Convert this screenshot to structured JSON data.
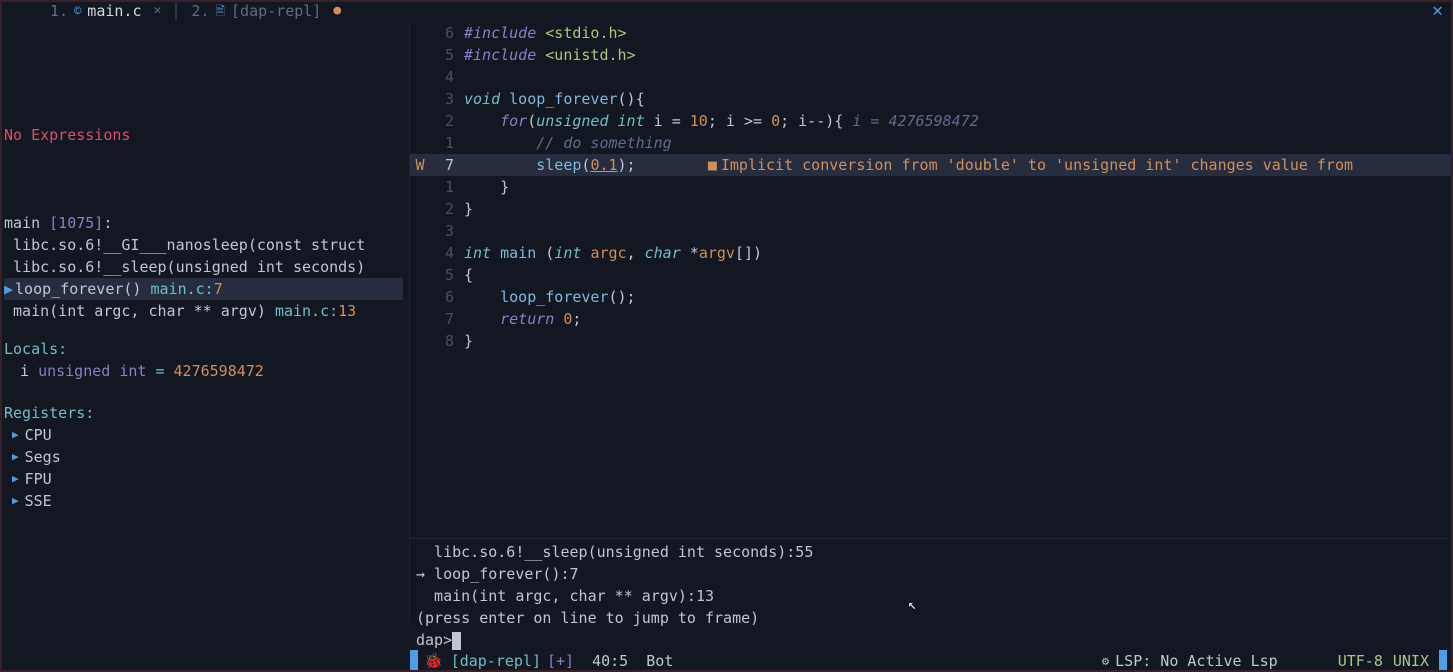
{
  "tabs": [
    {
      "num": "1.",
      "icon": "©",
      "label": "main.c",
      "active": true,
      "closable": true
    },
    {
      "num": "2.",
      "icon": "🗎",
      "label": "[dap-repl]",
      "active": false,
      "unsaved": true
    }
  ],
  "editor": {
    "diag_prefix": "W",
    "lines": [
      {
        "n": "6",
        "sign": "",
        "html": "<span class='kw'>#include</span> <span class='str'>&lt;stdio.h&gt;</span>"
      },
      {
        "n": "5",
        "sign": "",
        "html": "<span class='kw'>#include</span> <span class='str'>&lt;unistd.h&gt;</span>"
      },
      {
        "n": "4",
        "sign": "",
        "html": ""
      },
      {
        "n": "3",
        "sign": "",
        "html": "<span class='ty'>void</span> <span class='fn-name'>loop_forever</span><span class='punct'>(){</span>"
      },
      {
        "n": "2",
        "sign": "",
        "html": "    <span class='kw'>for</span><span class='punct'>(</span><span class='ty'>unsigned int</span> <span class='punct'>i</span> <span class='punct'>=</span> <span class='num'>10</span><span class='punct'>; i &gt;= </span><span class='num'>0</span><span class='punct'>; i--){</span> <span class='virtual'>i = 4276598472</span>"
      },
      {
        "n": "1",
        "sign": "",
        "html": "        <span class='cmt'>// do something</span>"
      },
      {
        "n": "7",
        "sign": "W",
        "hl": true,
        "html": "        <span class='fn-name'>sleep</span><span class='punct'>(</span><span class='num underline'>0.1</span><span class='punct'>);</span>        <span class='warn-sq'>■</span><span class='warn-msg'>Implicit conversion from 'double' to 'unsigned int' changes value from</span>"
      },
      {
        "n": "1",
        "sign": "",
        "html": "    <span class='punct'>}</span>"
      },
      {
        "n": "2",
        "sign": "",
        "html": "<span class='punct'>}</span>"
      },
      {
        "n": "3",
        "sign": "",
        "html": ""
      },
      {
        "n": "4",
        "sign": "",
        "html": "<span class='ty'>int</span> <span class='fn-name'>main</span> <span class='punct'>(</span><span class='ty'>int</span> <span class='param'>argc</span><span class='punct'>,</span> <span class='ty'>char</span> <span class='punct'>*</span><span class='param'>argv</span><span class='punct'>[])</span>"
      },
      {
        "n": "5",
        "sign": "",
        "html": "<span class='punct'>{</span>"
      },
      {
        "n": "6",
        "sign": "",
        "html": "    <span class='fn-name'>loop_forever</span><span class='punct'>();</span>"
      },
      {
        "n": "7",
        "sign": "",
        "html": "    <span class='kw'>return</span> <span class='num'>0</span><span class='punct'>;</span>"
      },
      {
        "n": "8",
        "sign": "",
        "html": "<span class='punct'>}</span>"
      }
    ]
  },
  "watches": {
    "empty_msg": "No Expressions"
  },
  "thread": {
    "name": "main",
    "id": "[1075]",
    "colon": ":"
  },
  "frames": [
    {
      "fn": "libc.so.6!__GI___nanosleep(const struct",
      "loc": "",
      "ln": ""
    },
    {
      "fn": "libc.so.6!__sleep(unsigned int seconds)",
      "loc": "",
      "ln": ""
    },
    {
      "fn": "loop_forever()",
      "loc": "main.c:",
      "ln": "7",
      "current": true
    },
    {
      "fn": "main(int argc, char ** argv)",
      "loc": "main.c:",
      "ln": "13"
    }
  ],
  "locals": {
    "title": "Locals:",
    "vars": [
      {
        "name": "i",
        "type": "unsigned int",
        "eq": "=",
        "value": "4276598472"
      }
    ]
  },
  "registers": {
    "title": "Registers:",
    "groups": [
      "CPU",
      "Segs",
      "FPU",
      "SSE"
    ]
  },
  "repl": {
    "lines": [
      "  libc.so.6!__sleep(unsigned int seconds):55",
      "→ loop_forever():7",
      "  main(int argc, char ** argv):13",
      "(press enter on line to jump to frame)"
    ],
    "prompt": "dap>"
  },
  "statusline": {
    "bufname": "[dap-repl]",
    "modified": "[+]",
    "pos": "40:5",
    "pct": "Bot",
    "lsp": "LSP: No Active Lsp",
    "encoding": "UTF-8",
    "fileformat": "UNIX"
  }
}
